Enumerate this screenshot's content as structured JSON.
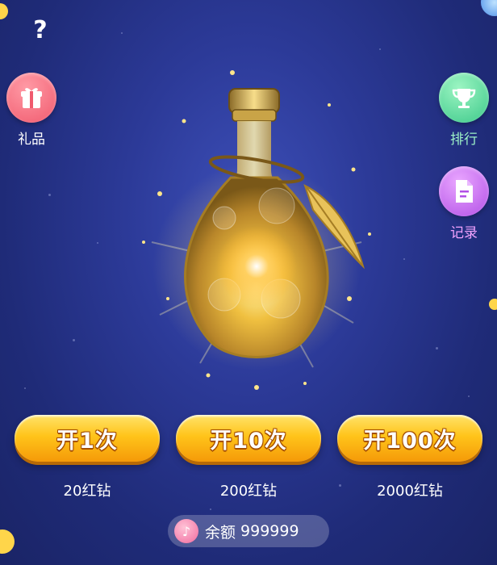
{
  "help": {
    "icon": "question-icon",
    "text": "?"
  },
  "sidebar_left": [
    {
      "label": "礼品",
      "icon": "gift-icon",
      "color": "#f05a6e"
    }
  ],
  "sidebar_right": [
    {
      "label": "排行",
      "icon": "trophy-icon",
      "color": "#3cc88a"
    },
    {
      "label": "记录",
      "icon": "document-icon",
      "color": "#b24fe6"
    }
  ],
  "centerpiece": {
    "icon": "magic-potion-bottle-icon"
  },
  "open_buttons": [
    {
      "label": "开1次",
      "price": "20红钻"
    },
    {
      "label": "开10次",
      "price": "200红钻"
    },
    {
      "label": "开100次",
      "price": "2000红钻"
    }
  ],
  "balance": {
    "icon": "music-note-icon",
    "label": "余额",
    "value": "999999"
  },
  "colors": {
    "background": "#2c3a98",
    "button_gold": "#ffc41a",
    "button_shadow": "#b86a06"
  }
}
